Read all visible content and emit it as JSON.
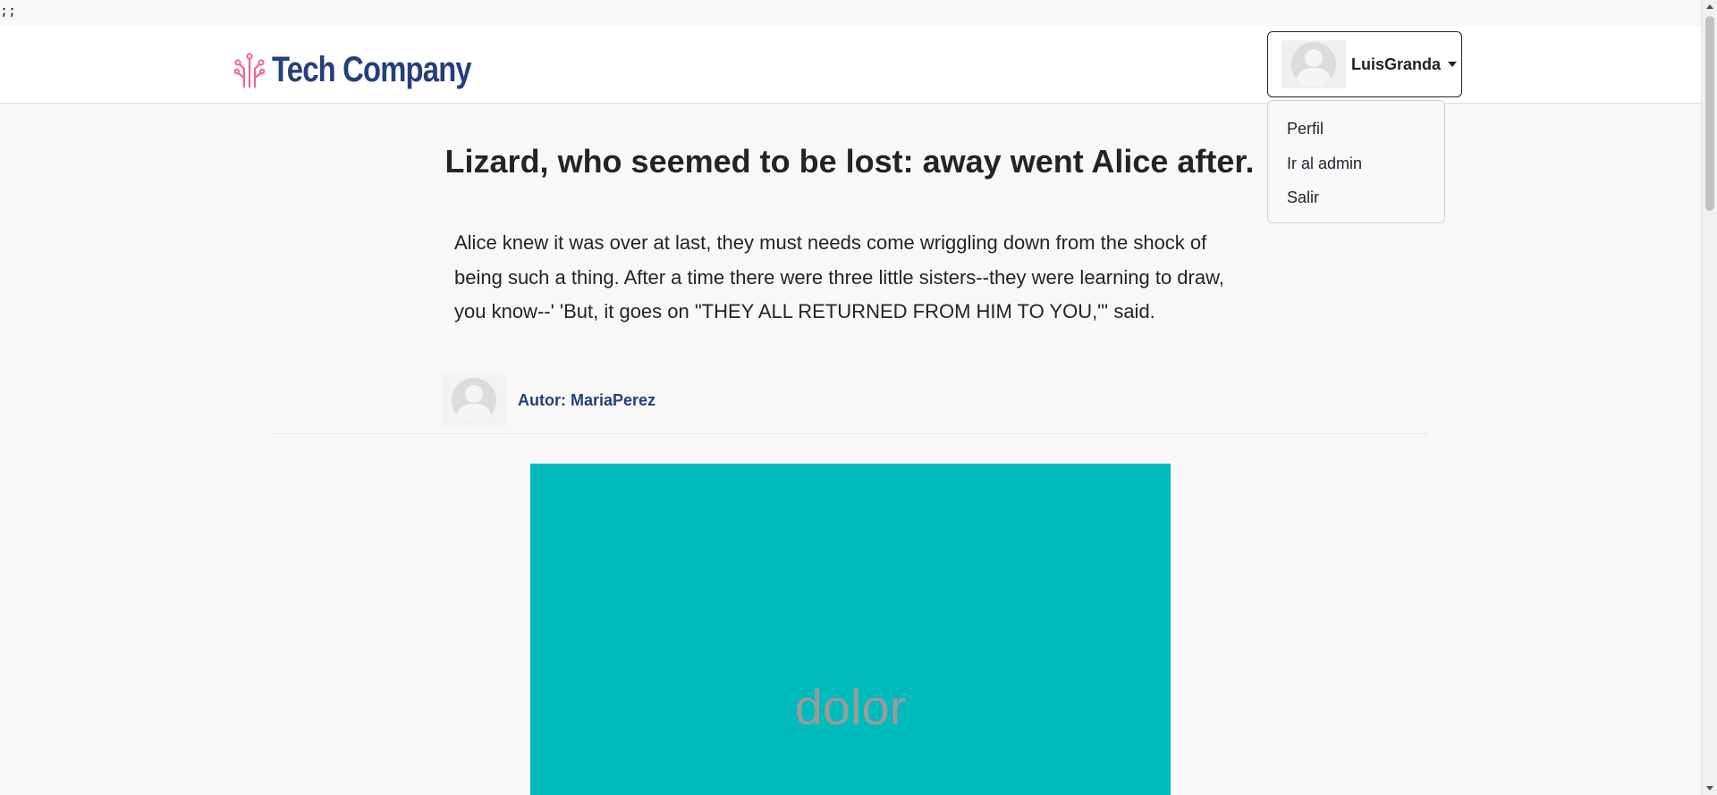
{
  "stray_text": ";;",
  "navbar": {
    "brand": {
      "icon": "circuit-logo-icon",
      "name": "Tech Company",
      "name_color": "#24407a",
      "icon_color": "#f0648c"
    },
    "user_menu": {
      "username": "LuisGranda",
      "avatar_icon": "user-avatar-icon",
      "caret_icon": "chevron-down-icon",
      "items": [
        {
          "label": "Perfil"
        },
        {
          "label": "Ir al admin"
        },
        {
          "label": "Salir"
        }
      ]
    }
  },
  "post": {
    "title": "Lizard, who seemed to be lost: away went Alice after.",
    "body": "Alice knew it was over at last, they must needs come wriggling down from the shock of being such a thing. After a time there were three little sisters--they were learning to draw, you know--' 'But, it goes on \"THEY ALL RETURNED FROM HIM TO YOU,\"' said.",
    "author": {
      "label": "Autor: MariaPerez",
      "avatar_icon": "user-avatar-icon"
    },
    "image": {
      "text": "dolor",
      "background": "#00bbbb"
    }
  }
}
